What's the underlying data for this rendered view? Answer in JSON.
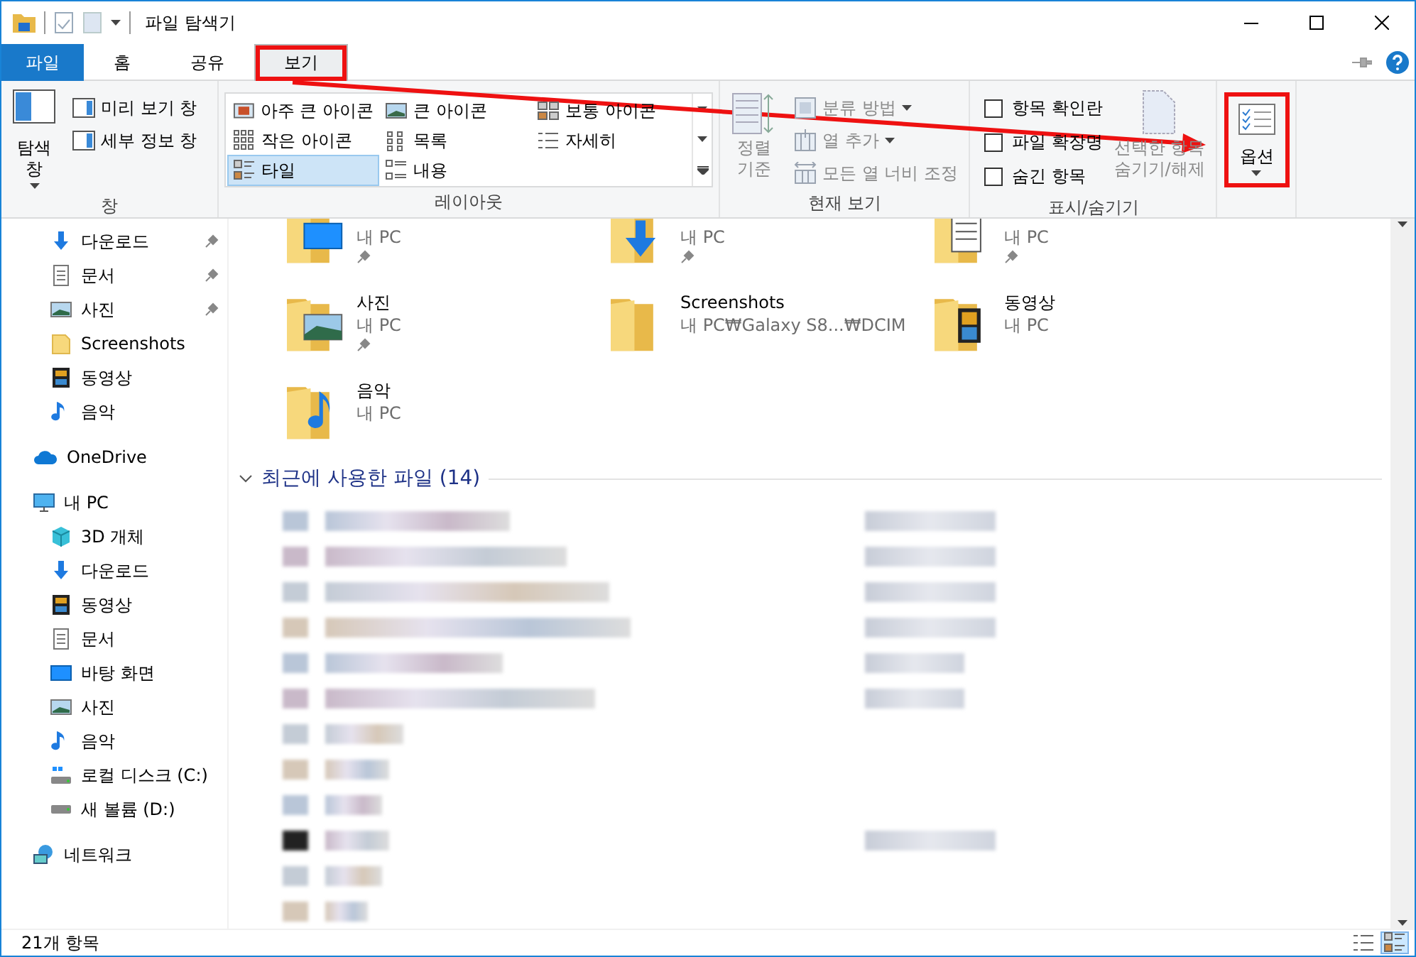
{
  "window": {
    "title": "파일 탐색기"
  },
  "tabs": [
    {
      "label": "파일",
      "kind": "file",
      "selected": false,
      "highlighted": false
    },
    {
      "label": "홈",
      "kind": "tab",
      "selected": false,
      "highlighted": false
    },
    {
      "label": "공유",
      "kind": "tab",
      "selected": false,
      "highlighted": false
    },
    {
      "label": "보기",
      "kind": "tab",
      "selected": true,
      "highlighted": true
    }
  ],
  "ribbon": {
    "panes": {
      "caption": "창",
      "nav_pane": "탐색\n창",
      "items": [
        {
          "label": "미리 보기 창",
          "selected": false
        },
        {
          "label": "세부 정보 창",
          "selected": false
        }
      ]
    },
    "layout": {
      "caption": "레이아웃",
      "items": [
        {
          "label": "아주 큰 아이콘",
          "kind": "xl",
          "selected": false
        },
        {
          "label": "큰 아이콘",
          "kind": "large",
          "selected": false
        },
        {
          "label": "보통 아이콘",
          "kind": "medium",
          "selected": false
        },
        {
          "label": "작은 아이콘",
          "kind": "small",
          "selected": false
        },
        {
          "label": "목록",
          "kind": "list",
          "selected": false
        },
        {
          "label": "자세히",
          "kind": "details",
          "selected": false
        },
        {
          "label": "타일",
          "kind": "tiles",
          "selected": true
        },
        {
          "label": "내용",
          "kind": "content",
          "selected": false
        }
      ]
    },
    "current_view": {
      "caption": "현재 보기",
      "sort": {
        "label": "정렬\n기준",
        "disabled": true
      },
      "items": [
        {
          "label": "분류 방법",
          "kind": "group",
          "dropdown": true,
          "disabled": true
        },
        {
          "label": "열 추가",
          "kind": "columns",
          "dropdown": true,
          "disabled": true
        },
        {
          "label": "모든 열 너비 조정",
          "kind": "fit",
          "dropdown": false,
          "disabled": true
        }
      ]
    },
    "show_hide": {
      "caption": "표시/숨기기",
      "checkboxes": [
        {
          "label": "항목 확인란",
          "checked": false
        },
        {
          "label": "파일 확장명",
          "checked": false
        },
        {
          "label": "숨긴 항목",
          "checked": false
        }
      ],
      "hide_selected": {
        "label": "선택한 항목\n숨기기/해제",
        "disabled": true
      }
    },
    "options": {
      "label": "옵션",
      "highlighted": true
    }
  },
  "sidebar": {
    "quick_access": [
      {
        "label": "다운로드",
        "kind": "download",
        "pinned": true
      },
      {
        "label": "문서",
        "kind": "document",
        "pinned": true
      },
      {
        "label": "사진",
        "kind": "picture",
        "pinned": true
      },
      {
        "label": "Screenshots",
        "kind": "folder",
        "pinned": false
      },
      {
        "label": "동영상",
        "kind": "video",
        "pinned": false
      },
      {
        "label": "음악",
        "kind": "music",
        "pinned": false
      }
    ],
    "items": [
      {
        "label": "OneDrive",
        "kind": "onedrive"
      },
      {
        "label": "내 PC",
        "kind": "pc",
        "children": [
          {
            "label": "3D 개체",
            "kind": "cube"
          },
          {
            "label": "다운로드",
            "kind": "download"
          },
          {
            "label": "동영상",
            "kind": "video"
          },
          {
            "label": "문서",
            "kind": "document"
          },
          {
            "label": "바탕 화면",
            "kind": "desktop"
          },
          {
            "label": "사진",
            "kind": "picture"
          },
          {
            "label": "음악",
            "kind": "music"
          },
          {
            "label": "로컬 디스크 (C:)",
            "kind": "systemdrive"
          },
          {
            "label": "새 볼륨 (D:)",
            "kind": "drive"
          }
        ]
      },
      {
        "label": "네트워크",
        "kind": "network"
      }
    ]
  },
  "folders": [
    {
      "path": "내 PC",
      "kind": "desktop",
      "pinned": true
    },
    {
      "path": "내 PC",
      "kind": "download",
      "pinned": true
    },
    {
      "path": "내 PC",
      "kind": "document",
      "pinned": true
    },
    {
      "name": "사진",
      "path": "내 PC",
      "kind": "picture",
      "pinned": true
    },
    {
      "name": "Screenshots",
      "path": "내 PC₩Galaxy S8...₩DCIM",
      "kind": "folder",
      "pinned": false
    },
    {
      "name": "동영상",
      "path": "내 PC",
      "kind": "video",
      "pinned": false
    },
    {
      "name": "음악",
      "path": "내 PC",
      "kind": "music",
      "pinned": false
    }
  ],
  "recent": {
    "title": "최근에 사용한 파일 (14)",
    "expanded": true
  },
  "status_bar": {
    "count": "21개 항목",
    "views": [
      {
        "kind": "details",
        "selected": false
      },
      {
        "kind": "tiles",
        "selected": true
      }
    ]
  }
}
